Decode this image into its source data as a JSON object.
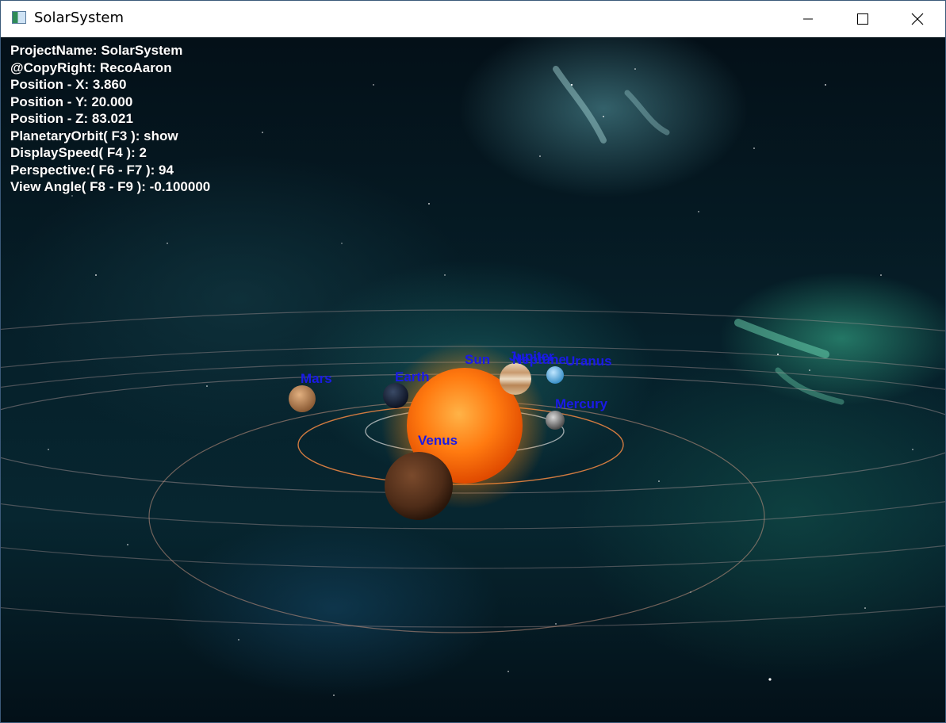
{
  "window": {
    "title": "SolarSystem",
    "icon": "app-window-icon",
    "controls": [
      "minimize-icon",
      "maximize-icon",
      "close-icon"
    ]
  },
  "hud": {
    "project_name": "ProjectName: SolarSystem",
    "copyright": "@CopyRight: RecoAaron",
    "position_x": "Position - X: 3.860",
    "position_y": "Position - Y: 20.000",
    "position_z": "Position - Z: 83.021",
    "planetary_orbit": "PlanetaryOrbit( F3 ): show",
    "display_speed": "DisplaySpeed( F4 ): 2",
    "perspective": "Perspective:( F6 - F7 ): 94",
    "view_angle": "View Angle( F8 - F9 ): -0.100000"
  },
  "planets": {
    "sun": "Sun",
    "mercury": "Mercury",
    "venus": "Venus",
    "earth": "Earth",
    "mars": "Mars",
    "jupiter": "Jupiter",
    "neptune": "Neptune",
    "uranus": "Uranus"
  },
  "colors": {
    "label": "#1a1ae6",
    "sun": "#ff7a10",
    "orbit": "#d07a40"
  }
}
